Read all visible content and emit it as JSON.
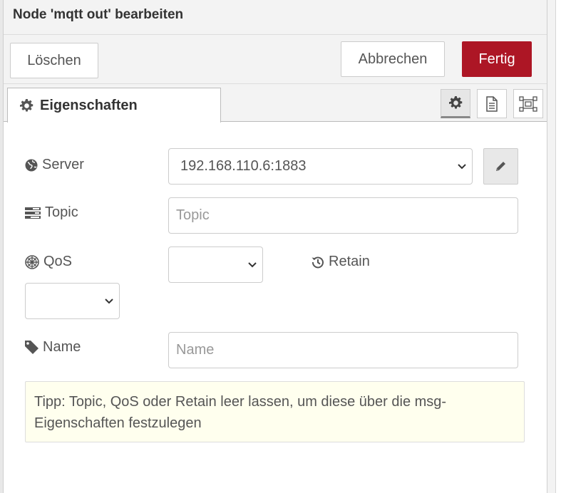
{
  "dialog": {
    "title": "Node 'mqtt out' bearbeiten",
    "delete_label": "Löschen",
    "cancel_label": "Abbrechen",
    "done_label": "Fertig"
  },
  "tabs": {
    "properties_label": "Eigenschaften"
  },
  "toolbar": {
    "icons": [
      "gear-icon",
      "description-icon",
      "appearance-icon"
    ]
  },
  "form": {
    "server": {
      "label": "Server",
      "value": "192.168.110.6:1883",
      "icon": "globe-icon"
    },
    "topic": {
      "label": "Topic",
      "placeholder": "Topic",
      "icon": "tasks-icon"
    },
    "qos": {
      "label": "QoS",
      "value": "",
      "icon": "empire-icon"
    },
    "retain": {
      "label": "Retain",
      "value": "",
      "icon": "history-icon"
    },
    "name": {
      "label": "Name",
      "placeholder": "Name",
      "icon": "tag-icon"
    }
  },
  "tip": {
    "text": "Tipp: Topic, QoS oder Retain leer lassen, um diese über die msg-Eigenschaften festzulegen"
  },
  "colors": {
    "primary_button": "#ad1625",
    "tip_background": "#ffffee"
  }
}
